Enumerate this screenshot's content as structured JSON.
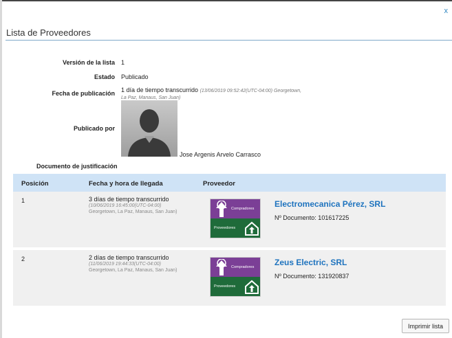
{
  "modal": {
    "close_label": "x",
    "title": "Lista de Proveedores",
    "print_label": "Imprimir lista"
  },
  "details": {
    "version_label": "Versión de la lista",
    "version_value": "1",
    "status_label": "Estado",
    "status_value": "Publicado",
    "pub_date_label": "Fecha de publicación",
    "pub_date_value": "1 día de tiempo transcurrido",
    "pub_date_stamp": "(13/06/2019 09:52:42(UTC-04:00) Georgetown,",
    "pub_date_tz": "La Paz, Manaus, San Juan)",
    "published_by_label": "Publicado por",
    "published_by_name": "Jose Argenis Arvelo Carrasco",
    "justification_label": "Documento de justificación"
  },
  "table": {
    "headers": [
      "Posición",
      "Fecha y hora de llegada",
      "Proveedor"
    ],
    "rows": [
      {
        "position": "1",
        "elapsed": "3 días de tiempo transcurrido",
        "stamp": "(10/06/2019 16:45:00(UTC-04:00)",
        "tz": "Georgetown, La Paz, Manaus, San Juan)",
        "badge_top": "Compradores",
        "badge_bottom": "Proveedores",
        "supplier": "Electromecanica Pérez, SRL",
        "doc": "Nº Documento: 101617225"
      },
      {
        "position": "2",
        "elapsed": "2 días de tiempo transcurrido",
        "stamp": "(11/06/2019 19:44:33(UTC-04:00)",
        "tz": "Georgetown, La Paz, Manaus, San Juan)",
        "badge_top": "Compradores",
        "badge_bottom": "Proveedores",
        "supplier": "Zeus Electric, SRL",
        "doc": "Nº Documento: 131920837"
      }
    ]
  },
  "colors": {
    "accent_link": "#1e73be",
    "header_bg": "#cfe3f6",
    "badge_purple": "#7b3f96",
    "badge_green": "#1f6b3a"
  }
}
